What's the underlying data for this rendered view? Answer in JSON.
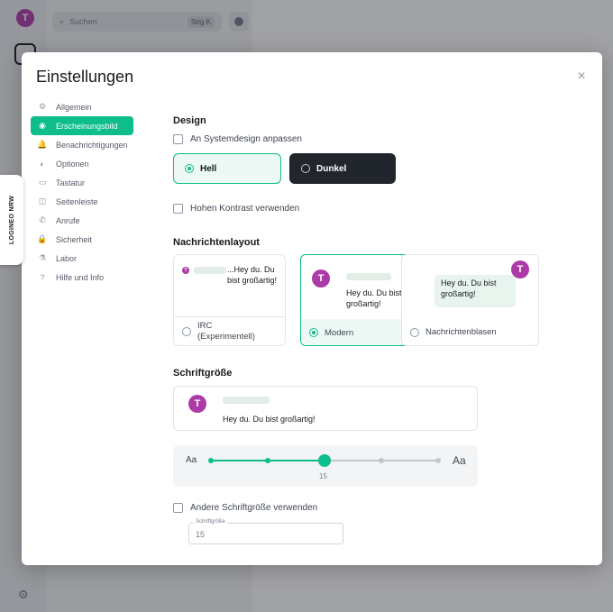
{
  "background": {
    "avatar_letter": "T",
    "search_placeholder": "Suchen",
    "search_shortcut": "Strg K"
  },
  "side_widget": {
    "label": "LOGINEO NRW"
  },
  "dialog": {
    "title": "Einstellungen",
    "close_label": "×"
  },
  "nav": {
    "items": [
      {
        "label": "Allgemein",
        "icon": "gear-icon",
        "glyph": "⚙"
      },
      {
        "label": "Erscheinungsbild",
        "icon": "eye-icon",
        "glyph": "◉",
        "active": true
      },
      {
        "label": "Benachrichtigungen",
        "icon": "bell-icon",
        "glyph": "🔔"
      },
      {
        "label": "Optionen",
        "icon": "toggle-icon",
        "glyph": "◐"
      },
      {
        "label": "Tastatur",
        "icon": "keyboard-icon",
        "glyph": "▭"
      },
      {
        "label": "Seitenleiste",
        "icon": "sidebar-icon",
        "glyph": "◫"
      },
      {
        "label": "Anrufe",
        "icon": "phone-icon",
        "glyph": "✆"
      },
      {
        "label": "Sicherheit",
        "icon": "lock-icon",
        "glyph": "🔒"
      },
      {
        "label": "Labor",
        "icon": "flask-icon",
        "glyph": "⚗"
      },
      {
        "label": "Hilfe und Info",
        "icon": "help-icon",
        "glyph": "?"
      }
    ]
  },
  "design": {
    "heading": "Design",
    "system_theme_label": "An Systemdesign anpassen",
    "light_label": "Hell",
    "dark_label": "Dunkel",
    "high_contrast_label": "Hohen Kontrast verwenden"
  },
  "layout": {
    "heading": "Nachrichtenlayout",
    "avatar_letter": "T",
    "irc_preview": "...Hey du. Du bist großartig!",
    "irc_label": "IRC (Experimentell)",
    "modern_preview": "Hey du. Du bist großartig!",
    "modern_label": "Modern",
    "bubble_preview": "Hey du. Du bist großartig!",
    "bubble_label": "Nachrichtenblasen"
  },
  "font": {
    "heading": "Schriftgröße",
    "avatar_letter": "T",
    "preview_text": "Hey du. Du bist großartig!",
    "slider_small_label": "Aa",
    "slider_large_label": "Aa",
    "slider_value": "15",
    "slider_position": 0.5,
    "custom_label": "Andere Schriftgröße verwenden",
    "field_label": "Schriftgröße",
    "field_value": "15"
  },
  "colors": {
    "accent": "#0dbd8b",
    "avatar": "#ac3ba8",
    "dark_theme": "#21262c"
  }
}
